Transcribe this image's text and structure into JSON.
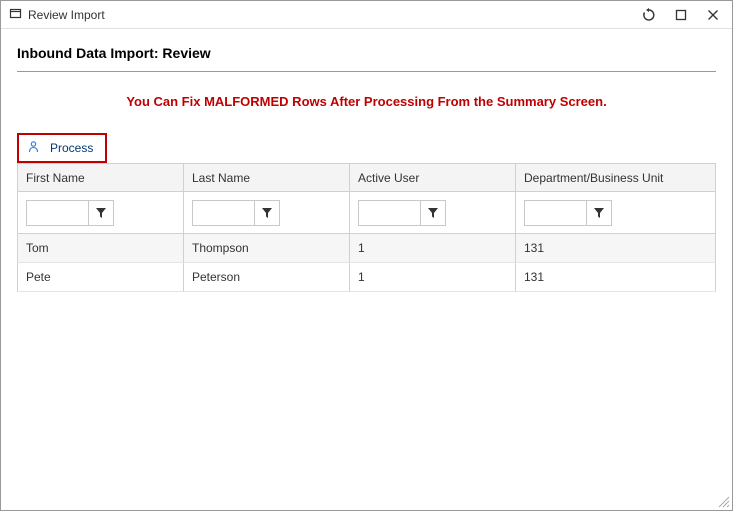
{
  "window": {
    "title": "Review Import"
  },
  "page": {
    "heading": "Inbound Data Import: Review",
    "warning": "You Can Fix MALFORMED Rows After Processing From the Summary Screen.",
    "processLabel": "Process"
  },
  "table": {
    "columns": [
      "First Name",
      "Last Name",
      "Active User",
      "Department/Business Unit"
    ],
    "rows": [
      {
        "firstName": "Tom",
        "lastName": "Thompson",
        "activeUser": "1",
        "department": "131"
      },
      {
        "firstName": "Pete",
        "lastName": "Peterson",
        "activeUser": "1",
        "department": "131"
      }
    ]
  }
}
